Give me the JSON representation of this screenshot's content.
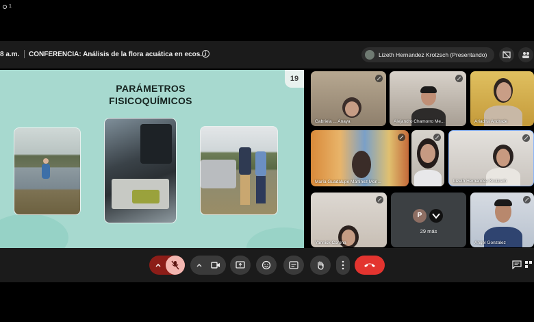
{
  "recording": {
    "count": "1"
  },
  "header": {
    "time": "8 a.m.",
    "title": "CONFERENCIA: Análisis de la flora acuática en ecos...",
    "presenter": "Lizeth Hernandez Krotzsch (Presentando)"
  },
  "slide": {
    "number": "19",
    "title_line1": "PARÁMETROS",
    "title_line2": "FISICOQUÍMICOS"
  },
  "participants": [
    {
      "name": "Gabriela ... Anaya"
    },
    {
      "name": "Alejandro Chamorro Me..."
    },
    {
      "name": "Ariadna Andrade"
    },
    {
      "name": "María Guadalupe Martinez Mon..."
    },
    {
      "name": ""
    },
    {
      "name": "Lizeth Hernandez Krotzsch"
    },
    {
      "name": "Yannick Corona"
    },
    {
      "name": "Angel Gonzalez"
    }
  ],
  "more": {
    "initial": "P",
    "count": "29 más"
  },
  "colors": {
    "end_call": "#e3342f",
    "mic_off": "#f3b6b0",
    "slide_bg": "#a7d9cf"
  }
}
